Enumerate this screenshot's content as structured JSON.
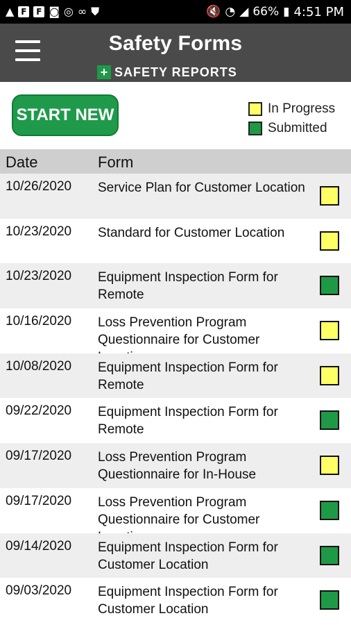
{
  "status_bar": {
    "battery": "66%",
    "time": "4:51 PM"
  },
  "header": {
    "title": "Safety Forms",
    "brand": "SAFETY REPORTS"
  },
  "actions": {
    "start_new": "START NEW"
  },
  "legend": [
    {
      "label": "In Progress",
      "color": "#ffff66"
    },
    {
      "label": "Submitted",
      "color": "#1e9a47"
    }
  ],
  "table": {
    "columns": [
      "Date",
      "Form"
    ],
    "rows": [
      {
        "date": "10/26/2020",
        "form": "Service Plan for Customer Location",
        "status": "In Progress"
      },
      {
        "date": "10/23/2020",
        "form": "Standard for Customer Location",
        "status": "In Progress"
      },
      {
        "date": "10/23/2020",
        "form": "Equipment Inspection Form for Remote",
        "status": "Submitted"
      },
      {
        "date": "10/16/2020",
        "form": "Loss Prevention Program Questionnaire for Customer Location",
        "status": "In Progress"
      },
      {
        "date": "10/08/2020",
        "form": "Equipment Inspection Form for Remote",
        "status": "In Progress"
      },
      {
        "date": "09/22/2020",
        "form": "Equipment Inspection Form for Remote",
        "status": "Submitted"
      },
      {
        "date": "09/17/2020",
        "form": "Loss Prevention Program Questionnaire for In-House",
        "status": "In Progress"
      },
      {
        "date": "09/17/2020",
        "form": "Loss Prevention Program Questionnaire for Customer Location",
        "status": "Submitted"
      },
      {
        "date": "09/14/2020",
        "form": "Equipment Inspection Form for Customer Location",
        "status": "Submitted"
      },
      {
        "date": "09/03/2020",
        "form": "Equipment Inspection Form for Customer Location",
        "status": "Submitted"
      }
    ]
  }
}
